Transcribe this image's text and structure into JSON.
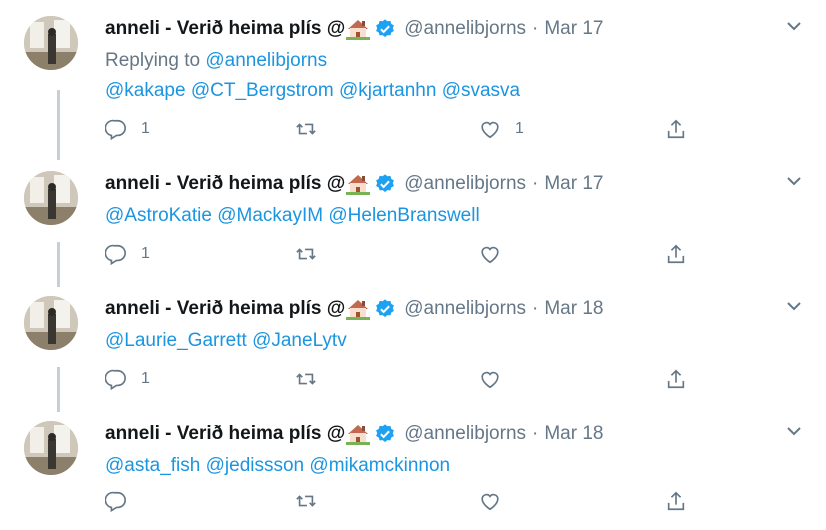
{
  "tweets": [
    {
      "name": "anneli - Verið heima plís @",
      "handle": "@annelibjorns",
      "sep": "·",
      "date": "Mar 17",
      "replying_prefix": "Replying to ",
      "replying_to": "@annelibjorns",
      "mentions": [
        "@kakape",
        "@CT_Bergstrom",
        "@kjartanhn",
        "@svasva"
      ],
      "reply_count": "1",
      "retweet_count": "",
      "like_count": "1"
    },
    {
      "name": "anneli - Verið heima plís @",
      "handle": "@annelibjorns",
      "sep": "·",
      "date": "Mar 17",
      "mentions": [
        "@AstroKatie",
        "@MackayIM",
        "@HelenBranswell"
      ],
      "reply_count": "1",
      "retweet_count": "",
      "like_count": ""
    },
    {
      "name": "anneli - Verið heima plís @",
      "handle": "@annelibjorns",
      "sep": "·",
      "date": "Mar 18",
      "mentions": [
        "@Laurie_Garrett",
        "@JaneLytv"
      ],
      "reply_count": "1",
      "retweet_count": "",
      "like_count": ""
    },
    {
      "name": "anneli - Verið heima plís @",
      "handle": "@annelibjorns",
      "sep": "·",
      "date": "Mar 18",
      "mentions": [
        "@asta_fish",
        "@jedissson",
        "@mikamckinnon"
      ],
      "reply_count": "",
      "retweet_count": "",
      "like_count": ""
    }
  ],
  "colors": {
    "mention": "#1b95e0",
    "meta": "#657786",
    "verified": "#1da1f2",
    "thread_line": "#c4cfd6"
  },
  "icons": [
    "house-emoji-icon",
    "verified-badge-icon",
    "chevron-down-icon",
    "reply-icon",
    "retweet-icon",
    "like-icon",
    "share-icon"
  ]
}
